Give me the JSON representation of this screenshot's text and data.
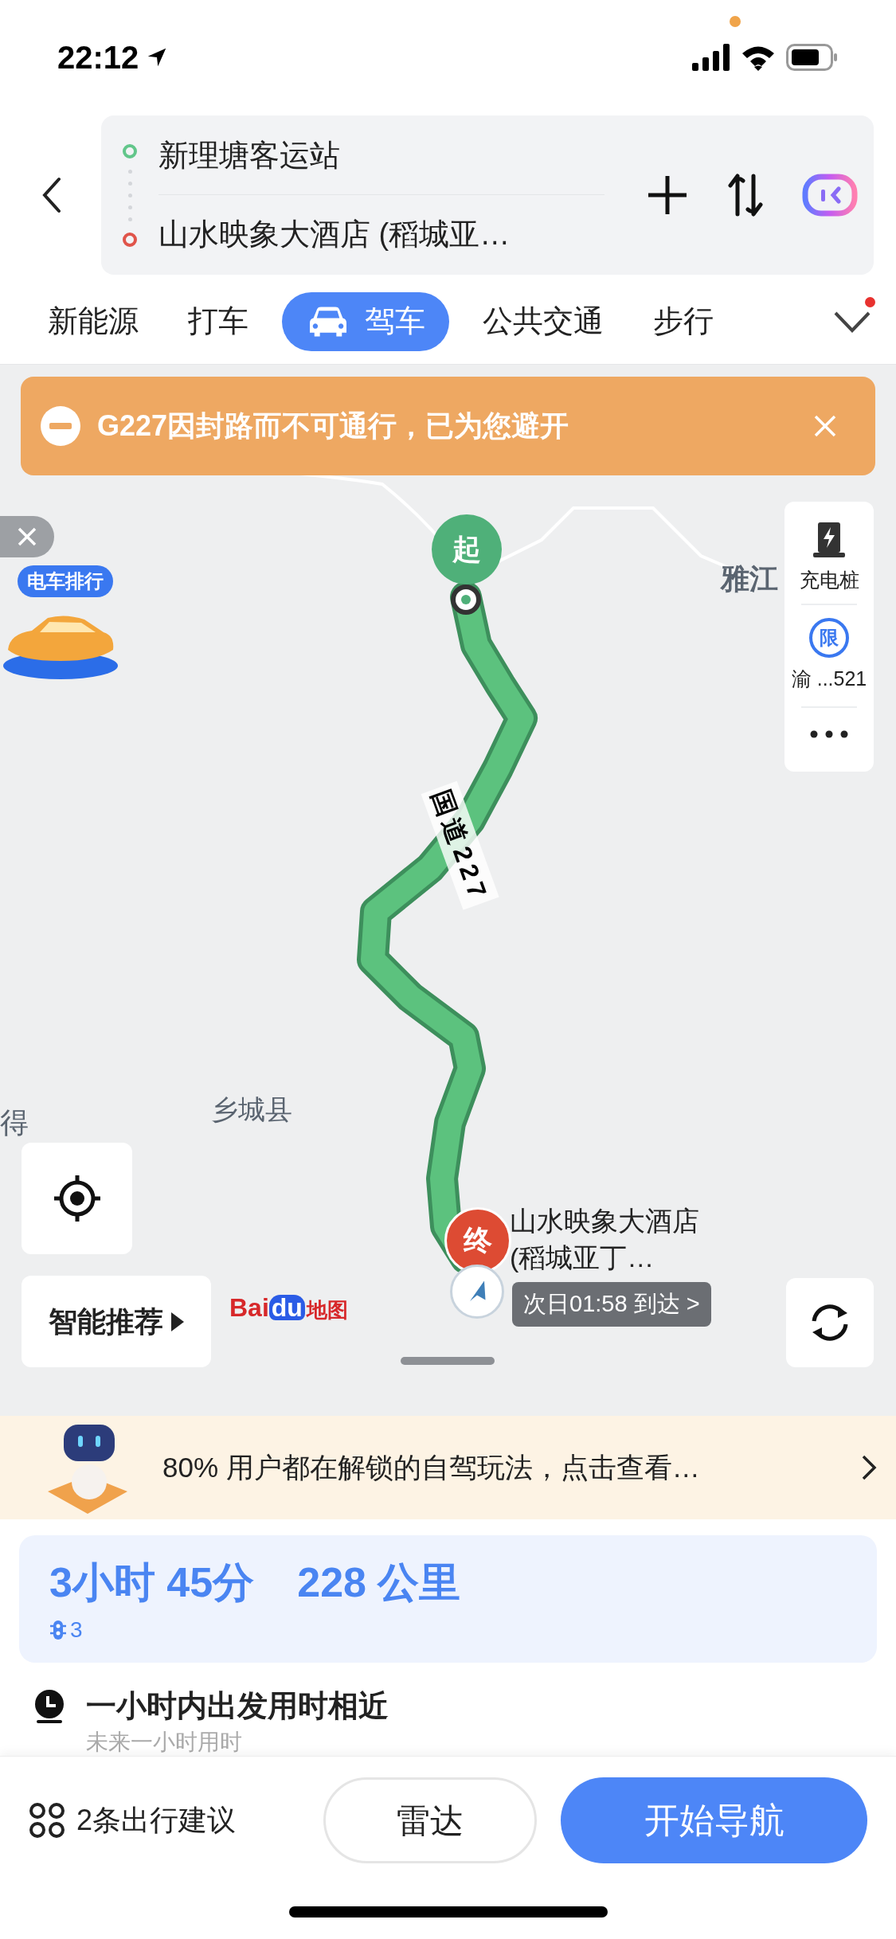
{
  "status_bar": {
    "time": "22:12"
  },
  "route_inputs": {
    "origin": "新理塘客运站",
    "destination": "山水映象大酒店 (稻城亚…"
  },
  "tabs": [
    {
      "label": "新能源",
      "selected": false,
      "icon": false
    },
    {
      "label": "打车",
      "selected": false,
      "icon": false
    },
    {
      "label": "驾车",
      "selected": true,
      "icon": true
    },
    {
      "label": "公共交通",
      "selected": false,
      "icon": false
    },
    {
      "label": "步行",
      "selected": false,
      "icon": false
    }
  ],
  "tabs_more": {
    "badge": true
  },
  "alert": {
    "text": "G227因封路而不可通行，已为您避开"
  },
  "map": {
    "labels": [
      {
        "text": "雅江"
      },
      {
        "text": "乡城县"
      },
      {
        "text": "得"
      }
    ],
    "route_label": "国道227",
    "start_marker": "起",
    "end_marker": "终",
    "destination_label": "山水映象大酒店 (稻城亚丁…",
    "arrival": "次日01:58 到达 >",
    "ev_ranking": "电车排行",
    "logo": {
      "a": "Bai",
      "b": "du",
      "c": "地图"
    },
    "smart": "智能推荐"
  },
  "side_tools": [
    {
      "kind": "charging",
      "label": "充电桩"
    },
    {
      "kind": "restriction",
      "label": "渝 ...521",
      "icon_text": "限"
    },
    {
      "kind": "more"
    }
  ],
  "promo": {
    "text": "80% 用户都在解锁的自驾玩法，点击查看…"
  },
  "summary": {
    "duration": "3小时 45分",
    "distance": "228 公里",
    "traffic_lights": "3"
  },
  "tip": {
    "title": "一小时内出发用时相近",
    "subtitle": "未来一小时用时"
  },
  "bottom": {
    "suggestions": "2条出行建议",
    "radar": "雷达",
    "navigate": "开始导航"
  }
}
